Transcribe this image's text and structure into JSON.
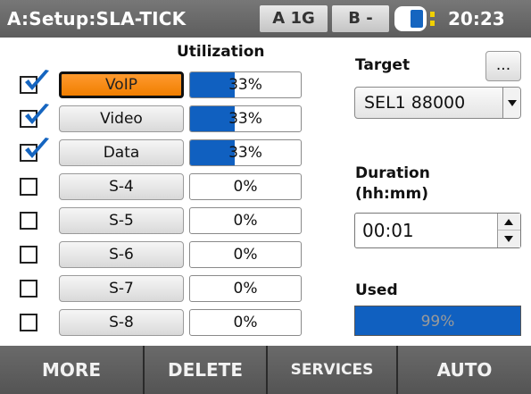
{
  "header": {
    "title": "A:Setup:SLA-TICK",
    "port_a": "A 1G",
    "port_b": "B -",
    "time": "20:23",
    "battery_icon": "battery-icon"
  },
  "utilization_title": "Utilization",
  "services": [
    {
      "label": "VoIP",
      "checked": true,
      "util": "33%",
      "fill_pct": 0.4,
      "active": true
    },
    {
      "label": "Video",
      "checked": true,
      "util": "33%",
      "fill_pct": 0.4,
      "active": false
    },
    {
      "label": "Data",
      "checked": true,
      "util": "33%",
      "fill_pct": 0.4,
      "active": false
    },
    {
      "label": "S-4",
      "checked": false,
      "util": "0%",
      "fill_pct": 0,
      "active": false
    },
    {
      "label": "S-5",
      "checked": false,
      "util": "0%",
      "fill_pct": 0,
      "active": false
    },
    {
      "label": "S-6",
      "checked": false,
      "util": "0%",
      "fill_pct": 0,
      "active": false
    },
    {
      "label": "S-7",
      "checked": false,
      "util": "0%",
      "fill_pct": 0,
      "active": false
    },
    {
      "label": "S-8",
      "checked": false,
      "util": "0%",
      "fill_pct": 0,
      "active": false
    }
  ],
  "target": {
    "label": "Target",
    "browse_label": "...",
    "selected": "SEL1 88000"
  },
  "duration": {
    "label_line1": "Duration",
    "label_line2": "(hh:mm)",
    "value": "00:01"
  },
  "used": {
    "label": "Used",
    "value": "99%",
    "fill_pct": 0.99
  },
  "softkeys": [
    "MORE",
    "DELETE",
    "SERVICES",
    "AUTO"
  ],
  "colors": {
    "accent_blue": "#1060c0",
    "active_orange": "#f07e00",
    "header_gray": "#666666"
  }
}
